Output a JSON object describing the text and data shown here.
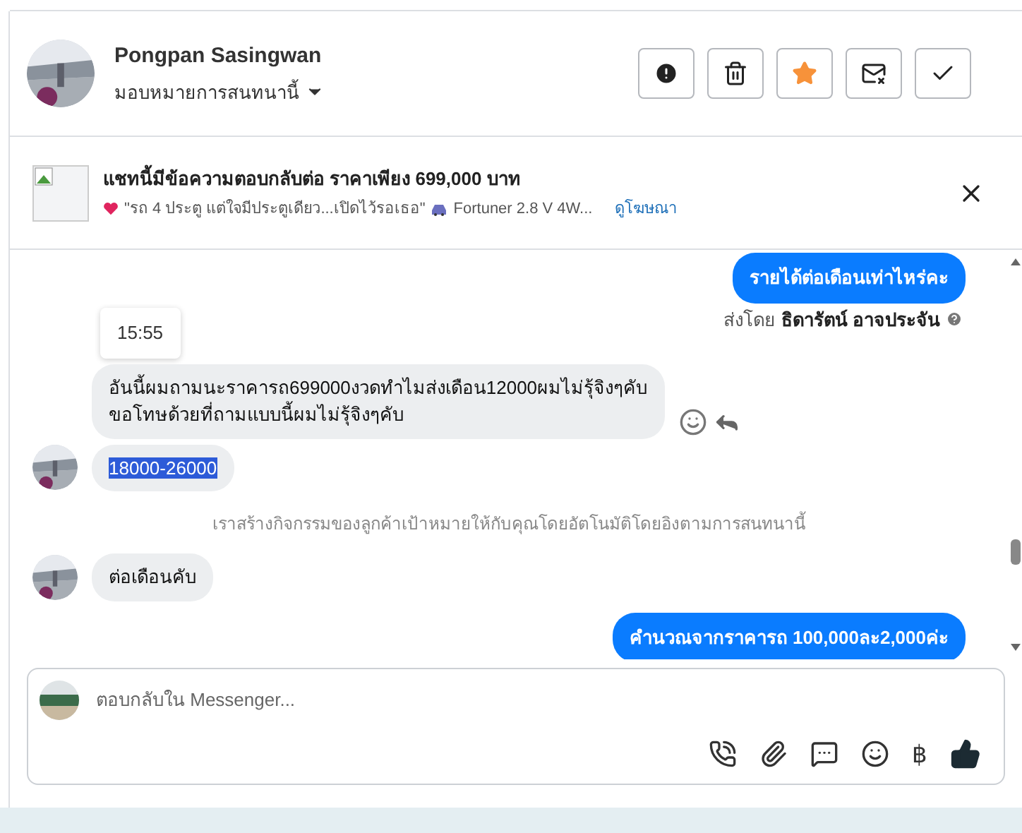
{
  "header": {
    "name": "Pongpan Sasingwan",
    "assign": "มอบหมายการสนทนานี้",
    "actions": [
      {
        "kind": "alert"
      },
      {
        "kind": "trash"
      },
      {
        "kind": "star"
      },
      {
        "kind": "mail"
      },
      {
        "kind": "check"
      }
    ]
  },
  "ad": {
    "title": "แชทนี้มีข้อความตอบกลับต่อ ราคาเพียง 699,000 บาท",
    "quote": "\"รถ 4 ประตู แต่ใจมีประตูเดียว...เปิดไว้รอเธอ\"",
    "car": "Fortuner 2.8 V 4W...",
    "link": "ดูโฆษณา"
  },
  "messages": [
    {
      "kind": "outgoing",
      "text": "รายได้ต่อเดือนเท่าไหร่คะ"
    },
    {
      "kind": "sender",
      "prefix": "ส่งโดย",
      "name": "ธิดารัตน์ อาจประจัน"
    },
    {
      "kind": "timestamp",
      "text": "15:55"
    },
    {
      "kind": "incoming",
      "text": "อันนี้ผมถามนะราคารถ699000งวดทำไมส่งเดือน12000ผมไม่รุ้จิงๆคับ\nขอโทษด้วยที่ถามแบบนี้ผมไม่รุ้จิงๆคับ",
      "avatar": false,
      "actions": true,
      "selected": false
    },
    {
      "kind": "incoming",
      "text": "18000-26000",
      "avatar": true,
      "actions": false,
      "selected": true
    },
    {
      "kind": "system",
      "text": "เราสร้างกิจกรรมของลูกค้าเป้าหมายให้กับคุณโดยอัตโนมัติโดยอิงตามการสนทนานี้"
    },
    {
      "kind": "incoming",
      "text": "ต่อเดือนคับ",
      "avatar": true,
      "actions": false,
      "selected": false
    },
    {
      "kind": "outgoing",
      "text": "คำนวณจากราคารถ 100,000ละ2,000ค่ะ"
    }
  ],
  "composer": {
    "placeholder": "ตอบกลับใน Messenger...",
    "currency": "฿"
  }
}
